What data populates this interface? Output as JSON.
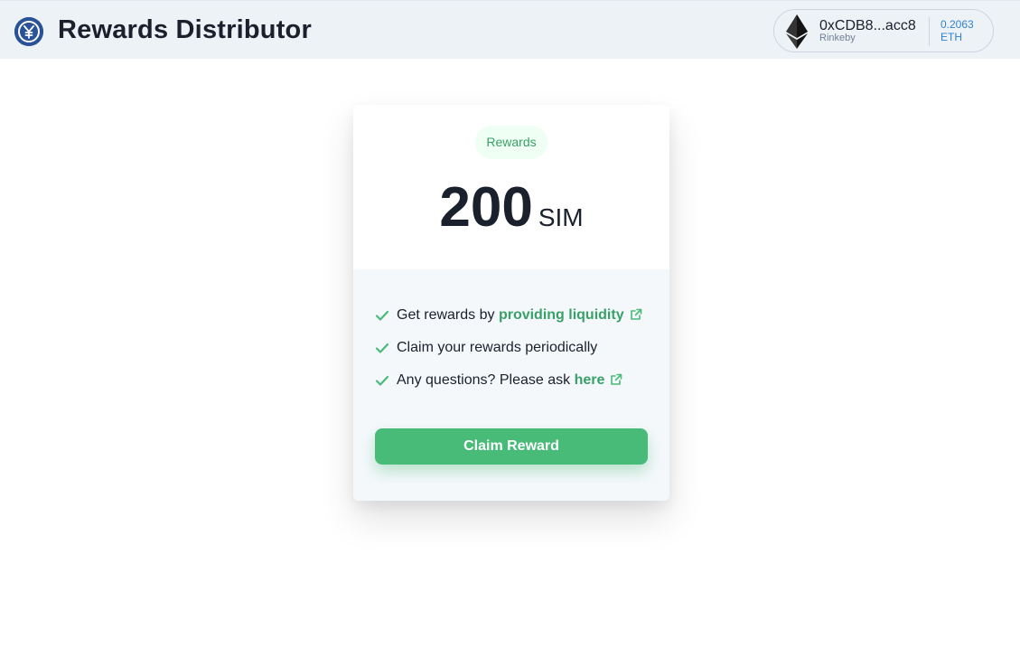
{
  "header": {
    "logo_icon": "yen-coin-icon",
    "title": "Rewards Distributor"
  },
  "wallet": {
    "icon": "ethereum-icon",
    "address": "0xCDB8...acc8",
    "network": "Rinkeby",
    "balance": "0.2063",
    "currency": "ETH"
  },
  "card": {
    "badge": "Rewards",
    "amount": "200",
    "unit": "SIM",
    "features": [
      {
        "text": "Get rewards by ",
        "link": "providing liquidity",
        "icon": "check-icon",
        "link_icon": "external-link-icon"
      },
      {
        "text": "Claim your rewards periodically",
        "icon": "check-icon"
      },
      {
        "text": "Any questions? Please ask ",
        "link": "here",
        "icon": "check-icon",
        "link_icon": "external-link-icon"
      }
    ],
    "claim_button": "Claim Reward"
  },
  "colors": {
    "accent": "#48bb78",
    "link": "#38a169",
    "header_bg": "#edf2f7",
    "balance": "#3182ce",
    "logo": "#2a5298"
  }
}
